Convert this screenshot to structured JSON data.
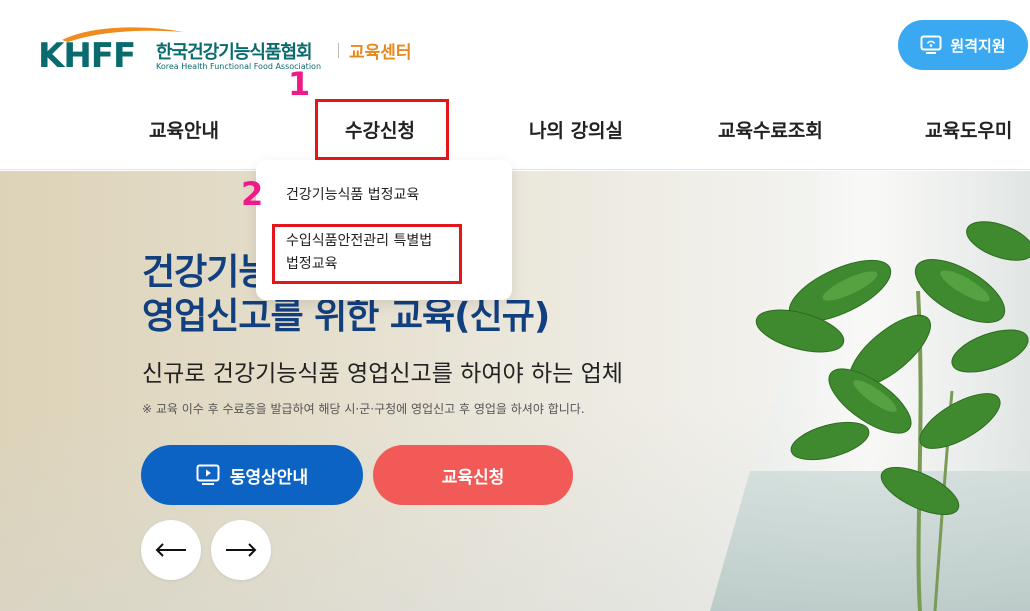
{
  "header": {
    "logo": {
      "mark": "KHFF",
      "org_name": "한국건강기능식품협회",
      "center": "교육센터",
      "org_english": "Korea Health Functional Food Association"
    },
    "remote_support_label": "원격지원",
    "nav": [
      {
        "label": "교육안내"
      },
      {
        "label": "수강신청"
      },
      {
        "label": "나의 강의실"
      },
      {
        "label": "교육수료조회"
      },
      {
        "label": "교육도우미"
      }
    ]
  },
  "dropdown": {
    "items": [
      {
        "label": "건강기능식품 법정교육"
      },
      {
        "label_line1": "수입식품안전관리 특별법",
        "label_line2": "법정교육"
      }
    ]
  },
  "annotations": {
    "step1": "1",
    "step2": "2"
  },
  "hero": {
    "title_line1": "건강기능",
    "title_line2": "영업신고를 위한 교육(신규)",
    "subtitle": "신규로 건강기능식품 영업신고를 하여야 하는 업체",
    "note": "※ 교육 이수 후 수료증을 발급하여 해당 시·군·구청에 영업신고 후 영업을 하셔야 합니다.",
    "video_button": "동영상안내",
    "apply_button": "교육신청",
    "prev_arrow": "←",
    "next_arrow": "→"
  },
  "colors": {
    "brand_teal": "#0a6b6e",
    "brand_orange": "#e8891b",
    "remote_blue": "#3aa9f1",
    "title_navy": "#123f7e",
    "video_blue": "#0d63c3",
    "apply_red": "#f25a57",
    "annotation_red": "#e2151b",
    "annotation_pink": "#ee1a8a"
  },
  "icons": {
    "remote": "remote-support-icon",
    "video": "video-play-icon",
    "prev": "arrow-left-icon",
    "next": "arrow-right-icon"
  }
}
